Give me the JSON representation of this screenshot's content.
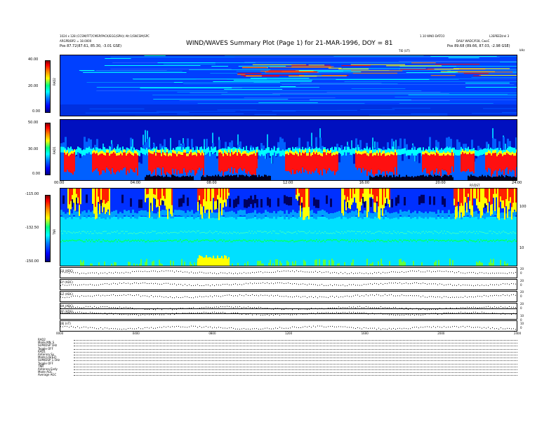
{
  "header": {
    "left_line1": "1024 x 128 (CCSM/FFT/CMSP/PACK/EGG(SPH)) Alt:1/SNCSM(SPC",
    "left_line2": "ARGPB/BP2 = 18.0000",
    "left_line3": "Pos   87.72(87.61, 85.30, -3.01 GSE)",
    "title": "WIND/WAVES Summary Plot (Page 1) for 21-MAR-1996, DOY = 81",
    "right_line1": "1.10  WNO-DATCO",
    "right_line1b": "L3SPEED/rel 3",
    "right_line2": "DAILY  WADC/P28, CwoC",
    "right_line3": "Pos   89.68 (89.66, 87.03, -2.98 GSE)",
    "tiny_center": "TIE (UT)",
    "tiny_right": "kHz"
  },
  "panels": {
    "rad2": {
      "label": "RAD2",
      "ticks": [
        "40.00",
        "20.00",
        "0.00"
      ]
    },
    "rad1": {
      "label": "RAD1",
      "ticks": [
        "50.00",
        "30.00",
        "0.00"
      ]
    },
    "tnr": {
      "label": "TNR",
      "ticks": [
        "-115.00",
        "-132.50",
        "-150.00"
      ],
      "right_ticks": [
        "100",
        "10"
      ]
    }
  },
  "time_axis": {
    "labels": [
      "00:00",
      "04:00",
      "08:00",
      "12:00",
      "16:00",
      "20:00",
      "24:00"
    ],
    "tiny_center": "RF/DST"
  },
  "traces": [
    {
      "label": "EX (ADC)"
    },
    {
      "label": "EY (ADC)"
    },
    {
      "label": "EZ (ADC)"
    },
    {
      "label": "BX (ADC)"
    },
    {
      "label": "BY (ADC)"
    },
    {
      "label": "|B| (nT)"
    }
  ],
  "trace_axis": {
    "labels": [
      "0000",
      "0400",
      "0800",
      "1200",
      "1600",
      "2000",
      "2400"
    ]
  },
  "trace_right_ticks": [
    "20",
    "0",
    "20",
    "0",
    "20",
    "0",
    "20",
    "0",
    "10",
    "0",
    "10",
    "0"
  ],
  "settings": [
    "RAD2",
    "Mode      MN_S",
    "SUM/DSP  1Hz",
    "Toggle    OFF",
    "RAD1",
    "Antenna   Sy",
    "Mode   LIS(EZ)",
    "SUM/DSP 1.5Hz",
    "Toggle    OFF",
    "TNR",
    "Antenna   Exdy",
    "Mode    AGC",
    "Average   AGC"
  ],
  "colors": {
    "dark_blue": "#0000a0",
    "blue": "#0030ff",
    "cyan": "#00ffff",
    "yellow": "#ffff00",
    "red": "#ff0000"
  }
}
